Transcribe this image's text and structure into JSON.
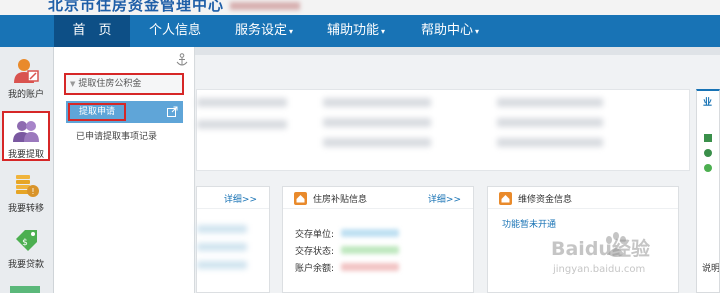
{
  "header": {
    "site_title": "北京市住房资金管理中心"
  },
  "nav": {
    "items": [
      {
        "label": "首　页",
        "caret": ""
      },
      {
        "label": "个人信息",
        "caret": ""
      },
      {
        "label": "服务设定",
        "caret": "▾"
      },
      {
        "label": "辅助功能",
        "caret": "▾"
      },
      {
        "label": "帮助中心",
        "caret": "▾"
      }
    ],
    "active_index": 0
  },
  "sidebar": {
    "items": [
      {
        "label": "我的账户",
        "icon": "user-account-icon"
      },
      {
        "label": "我要提取",
        "icon": "users-withdraw-icon"
      },
      {
        "label": "我要转移",
        "icon": "coins-transfer-icon"
      },
      {
        "label": "我要贷款",
        "icon": "tag-loan-icon"
      }
    ],
    "active_index": 1
  },
  "flyout": {
    "group_title": "提取住房公积金",
    "active_item": "提取申请",
    "item": "已申请提取事项记录"
  },
  "cards": [
    {
      "title": "",
      "more": "详细>>"
    },
    {
      "title": "住房补贴信息",
      "more": "详细>>",
      "fields": [
        "交存单位:",
        "交存状态:",
        "账户余额:"
      ]
    },
    {
      "title": "维修资金信息",
      "link": "功能暂未开通"
    }
  ],
  "right_panel": {
    "title": "业",
    "text": "说明"
  },
  "watermark": {
    "brand": "Baidu经验",
    "url": "jingyan.baidu.com"
  },
  "colors": {
    "nav_bg": "#1873b5",
    "nav_active": "#0d4f86",
    "highlight_red": "#d62727",
    "menu_active": "#5fa5d8",
    "link_blue": "#1873b5",
    "card_icon_orange": "#e98a2b"
  }
}
